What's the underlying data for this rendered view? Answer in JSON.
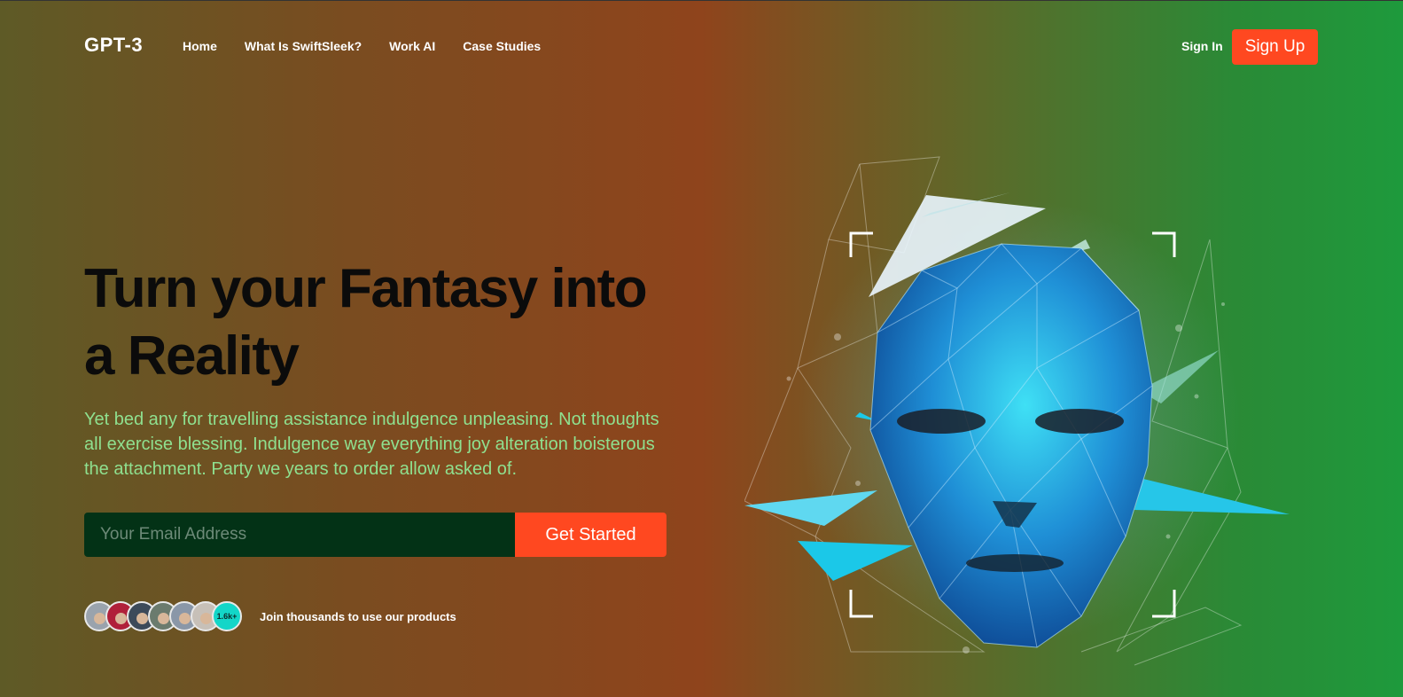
{
  "logo": "GPT-3",
  "nav": {
    "links": [
      "Home",
      "What Is SwiftSleek?",
      "Work AI",
      "Case Studies"
    ],
    "signin": "Sign In",
    "signup": "Sign Up"
  },
  "hero": {
    "title_line1": "Turn your Fantasy into",
    "title_line2": "a Reality",
    "text": "Yet bed any for travelling assistance indulgence unpleasing. Not thoughts all exercise blessing. Indulgence way everything joy alteration boisterous the attachment. Party we years to order allow asked of.",
    "email_placeholder": "Your Email Address",
    "cta": "Get Started",
    "avatar_count": "1.6k+",
    "join_text": "Join thousands to use our products"
  },
  "colors": {
    "accent": "#ff4820",
    "hero_text": "#8fe08f",
    "input_bg": "#033216"
  }
}
